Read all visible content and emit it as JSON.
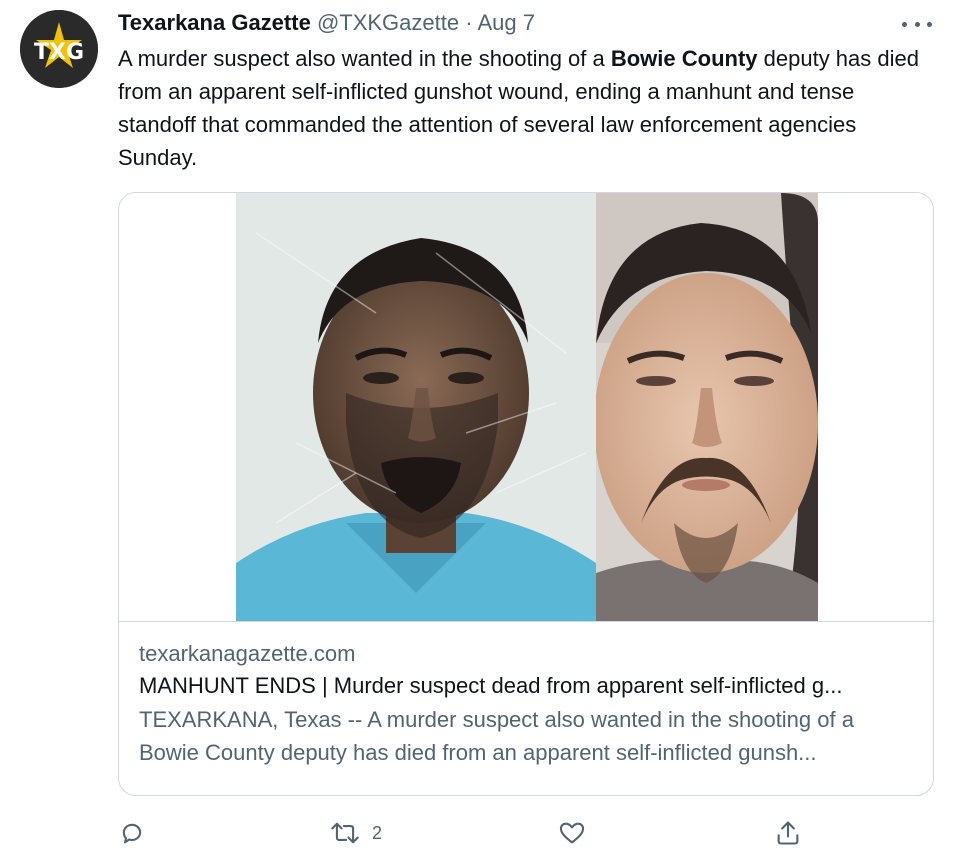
{
  "tweet": {
    "author_name": "Texarkana Gazette",
    "handle": "@TXKGazette",
    "separator": "·",
    "date": "Aug 7",
    "avatar_text": "TXG",
    "text_part1": "A murder suspect also wanted in the shooting of a ",
    "text_bold": "Bowie County",
    "text_part2": " deputy has died from an apparent self-inflicted gunshot wound, ending a manhunt and tense standoff that commanded the attention of several law enforcement agencies Sunday."
  },
  "card": {
    "domain": "texarkanagazette.com",
    "title": "MANHUNT ENDS | Murder suspect dead from apparent self-inflicted g...",
    "description": "TEXARKANA, Texas -- A murder suspect also wanted in the shooting of a Bowie County deputy has died from an apparent self-inflicted gunsh..."
  },
  "actions": {
    "reply_icon": "reply-icon",
    "retweet_icon": "retweet-icon",
    "retweet_count": "2",
    "like_icon": "heart-icon",
    "share_icon": "share-icon"
  },
  "colors": {
    "text_primary": "#0f1419",
    "text_secondary": "#536471",
    "border": "#cfd9de"
  }
}
